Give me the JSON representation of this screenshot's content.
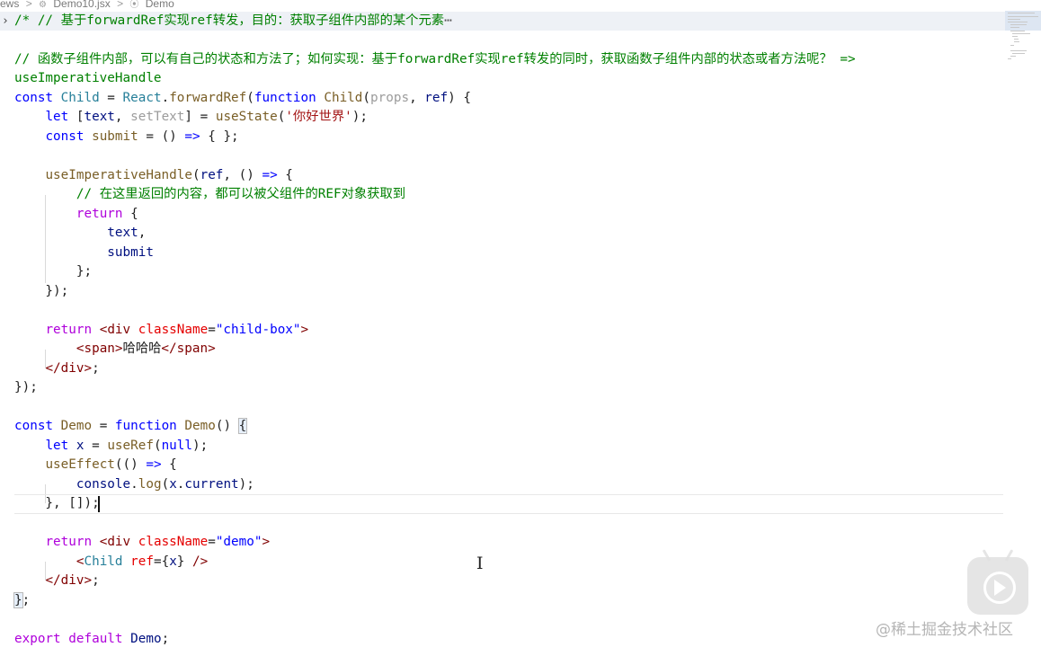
{
  "breadcrumb": {
    "items": [
      "ews",
      "Demo10.jsx",
      "Demo"
    ],
    "separator": ">"
  },
  "code": {
    "line1_comment": "/* // 基于forwardRef实现ref转发，目的：获取子组件内部的某个元素",
    "line1_ellipsis": "⋯",
    "line3_comment": "// 函数子组件内部，可以有自己的状态和方法了；如何实现：基于forwardRef实现ref转发的同时，获取函数子组件内部的状态或者方法呢？ =>",
    "line4": "useImperativeHandle",
    "child_const": "const",
    "child_name": "Child",
    "react": "React",
    "forward_ref": "forwardRef",
    "function_kw": "function",
    "props_param": "props",
    "ref_param": "ref",
    "let_kw": "let",
    "text_var": "text",
    "set_text_var": "setText",
    "use_state": "useState",
    "use_state_arg": "'你好世界'",
    "submit_var": "submit",
    "use_imperative_handle": "useImperativeHandle",
    "inner_comment": "// 在这里返回的内容，都可以被父组件的REF对象获取到",
    "return_kw": "return",
    "div_tag": "div",
    "class_name_attr": "className",
    "child_box_value": "\"child-box\"",
    "span_tag": "span",
    "span_text": "哈哈哈",
    "demo_name": "Demo",
    "x_var": "x",
    "use_ref": "useRef",
    "null_kw": "null",
    "use_effect": "useEffect",
    "console_obj": "console",
    "log_fn": "log",
    "current_prop": "current",
    "demo_value": "\"demo\"",
    "export_kw": "export",
    "default_kw": "default"
  },
  "watermark": "@稀土掘金技术社区",
  "icons": {
    "fold": "chevron-right-icon",
    "play": "play-icon",
    "cursor": "text-cursor-icon"
  },
  "colors": {
    "keyword": "#0000ff",
    "control_keyword": "#af00db",
    "function": "#795e26",
    "variable": "#001080",
    "type": "#267f99",
    "string": "#a31515",
    "comment": "#008000",
    "tag": "#800000",
    "attribute": "#e50000"
  }
}
